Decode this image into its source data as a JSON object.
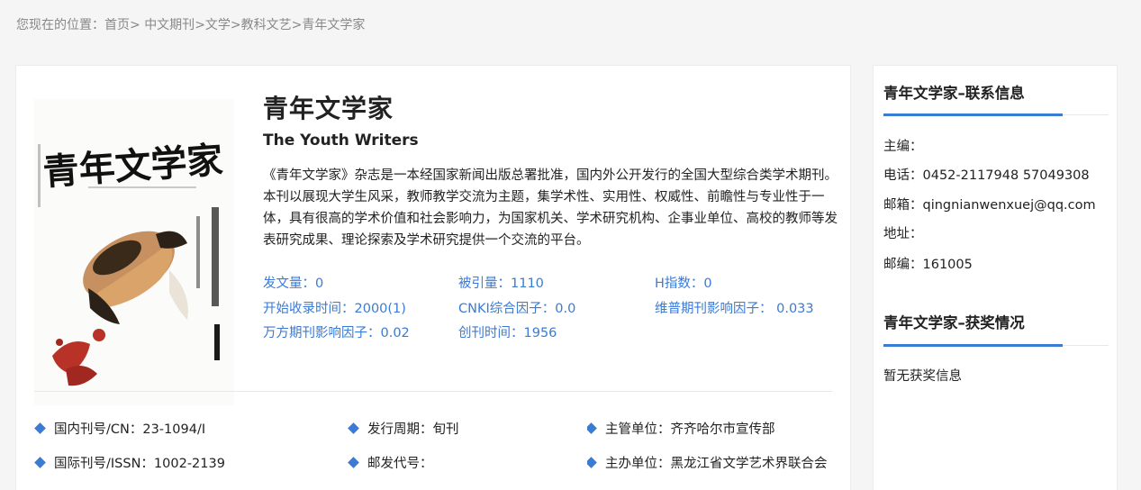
{
  "breadcrumb": {
    "prefix": "您现在的位置：",
    "home": "首页",
    "sep1": "> ",
    "category": "中文期刊",
    "sep2": ">",
    "subject": "文学",
    "sep3": ">",
    "subcategory": "教科文艺",
    "sep4": ">",
    "current": "青年文学家"
  },
  "journal": {
    "title": "青年文学家",
    "english_title": "The Youth Writers",
    "cover_text": "青年文学家",
    "description": "《青年文学家》杂志是一本经国家新闻出版总署批准，国内外公开发行的全国大型综合类学术期刊。本刊以展现大学生风采，教师教学交流为主题，集学术性、实用性、权威性、前瞻性与专业性于一体，具有很高的学术价值和社会影响力，为国家机关、学术研究机构、企事业单位、高校的教师等发表研究成果、理论探索及学术研究提供一个交流的平台。"
  },
  "stats": {
    "published": "发文量：0",
    "cited": "被引量：1110",
    "h_index": "H指数：0",
    "start_time": "开始收录时间：2000(1)",
    "cnki_factor": "CNKI综合因子：0.0",
    "vip_factor": "维普期刊影响因子： 0.033",
    "wanfang_factor": "万方期刊影响因子：0.02",
    "founded": "创刊时间：1956"
  },
  "details": {
    "cn": "国内刊号/CN：23-1094/I",
    "cycle": "发行周期：旬刊",
    "supervisor": "主管单位：齐齐哈尔市宣传部",
    "issn": "国际刊号/ISSN：1002-2139",
    "postcode": "邮发代号：",
    "sponsor": "主办单位：黑龙江省文学艺术界联合会"
  },
  "contact": {
    "title": "青年文学家–联系信息",
    "editor": "主编：",
    "phone": "电话：0452-2117948 57049308",
    "email": "邮箱：qingnianwenxuej@qq.com",
    "address": "地址：",
    "zip": "邮编：161005"
  },
  "awards": {
    "title": "青年文学家–获奖情况",
    "text": "暂无获奖信息"
  },
  "colors": {
    "accent": "#3a7bd5",
    "background": "#f5f5f5"
  }
}
